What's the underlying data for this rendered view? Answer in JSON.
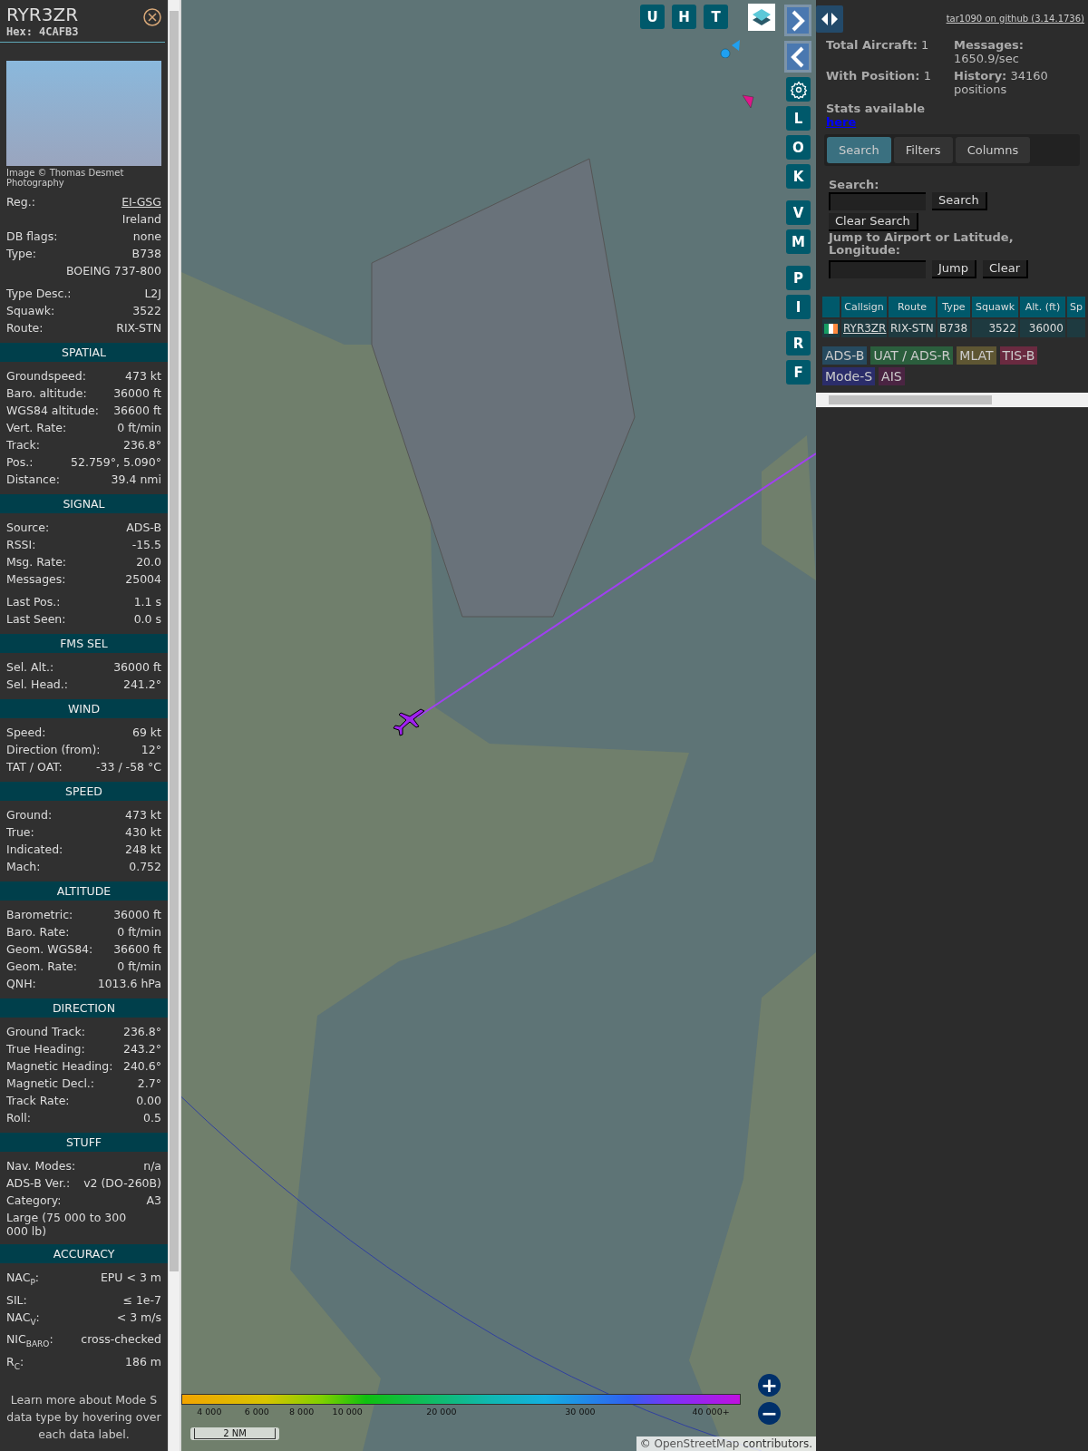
{
  "aircraft": {
    "callsign": "RYR3ZR",
    "hex": "Hex: 4CAFB3",
    "photo_caption": "Image © Thomas Desmet Photography"
  },
  "sections": [
    {
      "rows": [
        {
          "kind": "pair",
          "label": "Reg.:",
          "value": "EI-GSG",
          "link": true
        },
        {
          "kind": "value",
          "value": "Ireland"
        },
        {
          "kind": "pair",
          "label": "DB flags:",
          "value": "none"
        },
        {
          "kind": "pair",
          "label": "Type:",
          "value": "B738"
        },
        {
          "kind": "value",
          "value": "BOEING 737-800"
        },
        {
          "kind": "gap"
        },
        {
          "kind": "pair",
          "label": "Type Desc.:",
          "value": "L2J"
        },
        {
          "kind": "pair",
          "label": "Squawk:",
          "value": "3522"
        },
        {
          "kind": "pair",
          "label": "Route:",
          "value": "RIX-STN"
        }
      ]
    },
    {
      "title": "SPATIAL",
      "rows": [
        {
          "kind": "pair",
          "label": "Groundspeed:",
          "value": "473 kt"
        },
        {
          "kind": "pair",
          "label": "Baro. altitude:",
          "value": "36000 ft"
        },
        {
          "kind": "pair",
          "label": "WGS84 altitude:",
          "value": "36600 ft"
        },
        {
          "kind": "pair",
          "label": "Vert. Rate:",
          "value": "0 ft/min"
        },
        {
          "kind": "pair",
          "label": "Track:",
          "value": "236.8°"
        },
        {
          "kind": "pair",
          "label": "Pos.:",
          "value": "52.759°, 5.090°"
        },
        {
          "kind": "pair",
          "label": "Distance:",
          "value": "39.4 nmi"
        }
      ]
    },
    {
      "title": "SIGNAL",
      "rows": [
        {
          "kind": "pair",
          "label": "Source:",
          "value": "ADS-B"
        },
        {
          "kind": "pair",
          "label": "RSSI:",
          "value": "-15.5"
        },
        {
          "kind": "pair",
          "label": "Msg. Rate:",
          "value": "20.0"
        },
        {
          "kind": "pair",
          "label": "Messages:",
          "value": "25004"
        },
        {
          "kind": "gap"
        },
        {
          "kind": "pair",
          "label": "Last Pos.:",
          "value": "1.1 s"
        },
        {
          "kind": "pair",
          "label": "Last Seen:",
          "value": "0.0 s"
        }
      ]
    },
    {
      "title": "FMS SEL",
      "rows": [
        {
          "kind": "pair",
          "label": "Sel. Alt.:",
          "value": "36000 ft"
        },
        {
          "kind": "pair",
          "label": "Sel. Head.:",
          "value": "241.2°"
        }
      ]
    },
    {
      "title": "WIND",
      "rows": [
        {
          "kind": "pair",
          "label": "Speed:",
          "value": "69 kt"
        },
        {
          "kind": "pair",
          "label": "Direction (from):",
          "value": "12°"
        },
        {
          "kind": "pair",
          "label": "TAT / OAT:",
          "value": "-33 / -58 °C"
        }
      ]
    },
    {
      "title": "SPEED",
      "rows": [
        {
          "kind": "pair",
          "label": "Ground:",
          "value": "473 kt"
        },
        {
          "kind": "pair",
          "label": "True:",
          "value": "430 kt"
        },
        {
          "kind": "pair",
          "label": "Indicated:",
          "value": "248 kt"
        },
        {
          "kind": "pair",
          "label": "Mach:",
          "value": "0.752"
        }
      ]
    },
    {
      "title": "ALTITUDE",
      "rows": [
        {
          "kind": "pair",
          "label": "Barometric:",
          "value": "36000 ft"
        },
        {
          "kind": "pair",
          "label": "Baro. Rate:",
          "value": "0 ft/min"
        },
        {
          "kind": "pair",
          "label": "Geom. WGS84:",
          "value": "36600 ft"
        },
        {
          "kind": "pair",
          "label": "Geom. Rate:",
          "value": "0 ft/min"
        },
        {
          "kind": "pair",
          "label": "QNH:",
          "value": "1013.6 hPa"
        }
      ]
    },
    {
      "title": "DIRECTION",
      "rows": [
        {
          "kind": "pair",
          "label": "Ground Track:",
          "value": "236.8°"
        },
        {
          "kind": "pair",
          "label": "True Heading:",
          "value": "243.2°"
        },
        {
          "kind": "pair",
          "label": "Magnetic Heading:",
          "value": "240.6°"
        },
        {
          "kind": "pair",
          "label": "Magnetic Decl.:",
          "value": "2.7°"
        },
        {
          "kind": "pair",
          "label": "Track Rate:",
          "value": "0.00"
        },
        {
          "kind": "pair",
          "label": "Roll:",
          "value": "0.5"
        }
      ]
    },
    {
      "title": "STUFF",
      "rows": [
        {
          "kind": "pair",
          "label": "Nav. Modes:",
          "value": "n/a"
        },
        {
          "kind": "pair",
          "label": "ADS-B Ver.:",
          "value": "v2 (DO-260B)"
        },
        {
          "kind": "pair",
          "label": "Category:",
          "value": "A3"
        },
        {
          "kind": "note",
          "value": "Large (75 000 to 300 000 lb)"
        }
      ]
    },
    {
      "title": "ACCURACY",
      "rows": [
        {
          "kind": "pair",
          "label": "NAC$_{P}$:",
          "value": "EPU < 3 m"
        },
        {
          "kind": "pair",
          "label": "SIL:",
          "value": "≤ 1e-7"
        },
        {
          "kind": "pair",
          "label": "NAC$_{V}$:",
          "value": "< 3 m/s"
        },
        {
          "kind": "pair",
          "label": "NIC$_{BARO}$:",
          "value": "cross-checked"
        },
        {
          "kind": "pair",
          "label": "R$_{C}$:",
          "value": "186 m"
        }
      ]
    }
  ],
  "sidebar_footer": "Learn more about Mode S data type by hovering over each data label.",
  "map": {
    "top_buttons": [
      "U",
      "H",
      "T"
    ],
    "side_buttons": [
      {
        "kind": "arrow_right"
      },
      {
        "kind": "arrow_left"
      },
      {
        "kind": "gear"
      },
      {
        "kind": "letter",
        "label": "L"
      },
      {
        "kind": "letter",
        "label": "O"
      },
      {
        "kind": "letter",
        "label": "K"
      },
      {
        "kind": "letter",
        "label": "V"
      },
      {
        "kind": "letter",
        "label": "M"
      },
      {
        "kind": "letter",
        "label": "P"
      },
      {
        "kind": "letter",
        "label": "I"
      },
      {
        "kind": "letter",
        "label": "R"
      },
      {
        "kind": "letter",
        "label": "F"
      }
    ],
    "altitude_legend": [
      "4 000",
      "6 000",
      "8 000",
      "10 000",
      "20 000",
      "30 000",
      "40 000+"
    ],
    "zoom_buttons": [
      "+",
      "−"
    ],
    "scale": "2 NM",
    "attribution": {
      "prefix": "©",
      "link": "OpenStreetMap",
      "suffix": "contributors."
    }
  },
  "panel": {
    "github_link": "tar1090 on github (3.14.1736)",
    "stats": [
      {
        "label": "Total Aircraft:",
        "value": "1"
      },
      {
        "label": "Messages:",
        "value": "1650.9/sec"
      },
      {
        "label": "With Position:",
        "value": "1"
      },
      {
        "label": "History:",
        "value": "34160 positions"
      }
    ],
    "stats_note": "Stats available",
    "stats_link": "here",
    "tabs": [
      {
        "label": "Search",
        "selected": true
      },
      {
        "label": "Filters",
        "selected": false
      },
      {
        "label": "Columns",
        "selected": false
      }
    ],
    "search_label": "Search:",
    "search_button": "Search",
    "clear_search_button": "Clear Search",
    "jump_label": "Jump to Airport or Latitude, Longitude:",
    "jump_button": "Jump",
    "clear_button": "Clear",
    "table": {
      "columns": [
        "Callsign",
        "Route",
        "Type",
        "Squawk",
        "Alt. (ft)",
        "Sp"
      ],
      "rows": [
        {
          "callsign": "RYR3ZR",
          "route": "RIX-STN",
          "type": "B738",
          "squawk": "3522",
          "altitude": "36000"
        }
      ]
    },
    "source_tags": [
      {
        "label": "ADS-B",
        "color": "#264a5f"
      },
      {
        "label": "UAT / ADS-R",
        "color": "#2b5e3d"
      },
      {
        "label": "MLAT",
        "color": "#5e5633"
      },
      {
        "label": "TIS-B",
        "color": "#6a2a40"
      },
      {
        "label": "Mode-S",
        "color": "#2b2d6a"
      },
      {
        "label": "AIS",
        "color": "#4a2442"
      }
    ]
  }
}
